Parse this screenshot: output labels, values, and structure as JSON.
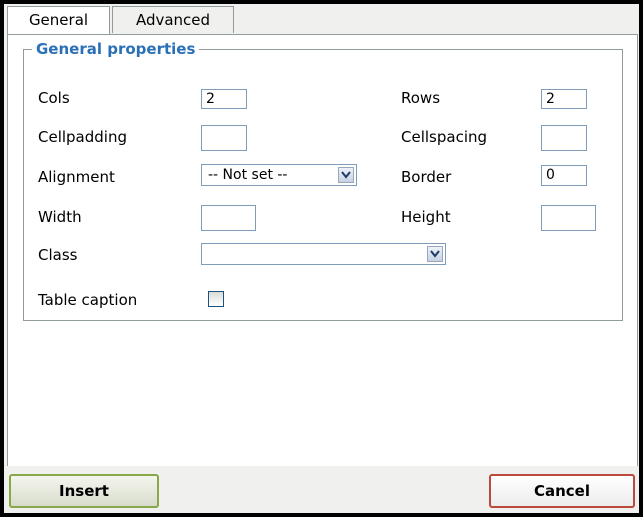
{
  "tabs": [
    {
      "label": "General",
      "active": true
    },
    {
      "label": "Advanced",
      "active": false
    }
  ],
  "fieldset": {
    "legend": "General properties"
  },
  "fields": {
    "cols": {
      "label": "Cols",
      "value": "2"
    },
    "rows": {
      "label": "Rows",
      "value": "2"
    },
    "cellpadding": {
      "label": "Cellpadding",
      "value": ""
    },
    "cellspacing": {
      "label": "Cellspacing",
      "value": ""
    },
    "alignment": {
      "label": "Alignment",
      "value": "-- Not set --"
    },
    "border": {
      "label": "Border",
      "value": "0"
    },
    "width": {
      "label": "Width",
      "value": ""
    },
    "height": {
      "label": "Height",
      "value": ""
    },
    "class": {
      "label": "Class",
      "value": ""
    },
    "caption": {
      "label": "Table caption",
      "checked": false
    }
  },
  "buttons": {
    "insert": "Insert",
    "cancel": "Cancel"
  },
  "colors": {
    "legend": "#2b6fb6",
    "insert_border": "#8aa84a",
    "cancel_border": "#b94a3c"
  },
  "icons": {
    "select_arrow": "chevron-down-icon"
  }
}
